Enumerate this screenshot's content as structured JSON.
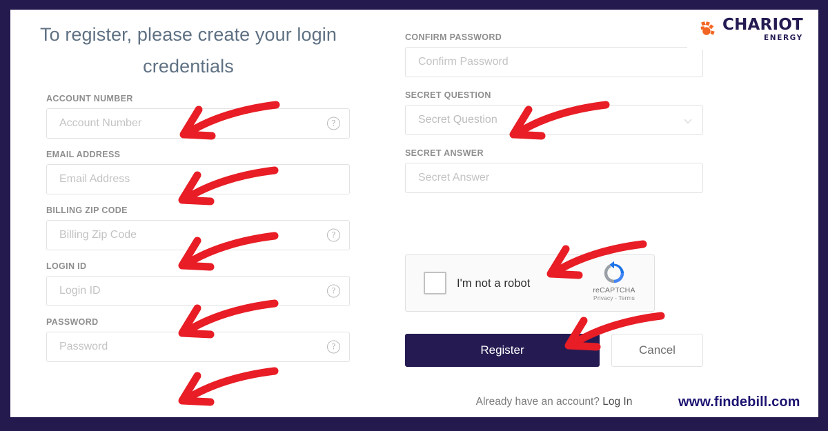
{
  "brand": {
    "name": "CHARIOT",
    "tagline": "ENERGY",
    "navy": "#251b52",
    "orange": "#f26522"
  },
  "watermark": "www.findebill.com",
  "heading": "To register, please create your login credentials",
  "left_column": [
    {
      "label": "ACCOUNT NUMBER",
      "placeholder": "Account Number",
      "value": "",
      "help_icon": "help-circle-icon",
      "name": "account-number"
    },
    {
      "label": "EMAIL ADDRESS",
      "placeholder": "Email Address",
      "value": "",
      "help_icon": "",
      "name": "email-address"
    },
    {
      "label": "BILLING ZIP CODE",
      "placeholder": "Billing Zip Code",
      "value": "",
      "help_icon": "help-circle-icon",
      "name": "billing-zip-code"
    },
    {
      "label": "LOGIN ID",
      "placeholder": "Login ID",
      "value": "",
      "help_icon": "help-circle-icon",
      "name": "login-id"
    },
    {
      "label": "PASSWORD",
      "placeholder": "Password",
      "value": "",
      "help_icon": "help-circle-icon",
      "name": "password"
    }
  ],
  "right_column": [
    {
      "label": "CONFIRM PASSWORD",
      "placeholder": "Confirm Password",
      "value": "",
      "help_icon": "",
      "name": "confirm-password"
    },
    {
      "label": "SECRET QUESTION",
      "placeholder": "Secret Question",
      "value": "",
      "help_icon": "chevron-down-icon",
      "name": "secret-question"
    },
    {
      "label": "SECRET ANSWER",
      "placeholder": "Secret Answer",
      "value": "",
      "help_icon": "",
      "name": "secret-answer"
    }
  ],
  "recaptcha": {
    "checkbox_label": "I'm not a robot",
    "brand": "reCAPTCHA",
    "terms": "Privacy - Terms",
    "checked": false
  },
  "actions": {
    "register": "Register",
    "cancel": "Cancel"
  },
  "footer": {
    "prompt": "Already have an account?",
    "link": "Log In"
  },
  "annotations": {
    "arrow_color": "#e81d25",
    "count": 8,
    "targets": [
      "account-number-input",
      "email-address-input",
      "billing-zip-code-input",
      "login-id-input",
      "password-input",
      "secret-question-select",
      "recaptcha-checkbox",
      "register-button"
    ]
  }
}
